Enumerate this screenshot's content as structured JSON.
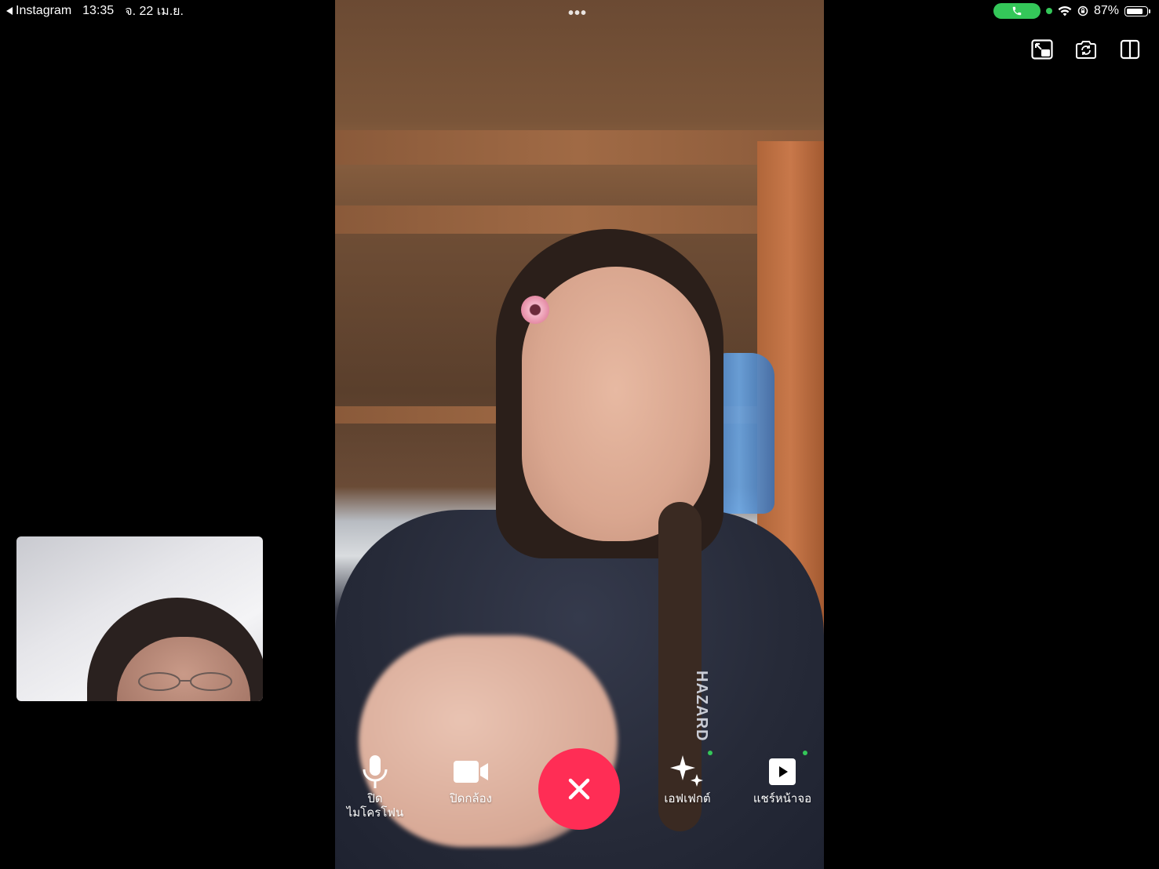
{
  "status_bar": {
    "back_app": "Instagram",
    "time": "13:35",
    "date": "จ. 22 เม.ย.",
    "battery": "87%",
    "battery_level": 0.87
  },
  "remote_video": {
    "shirt_text": "HAZARD"
  },
  "top_toolbar": {
    "icons": [
      "picture-in-picture-icon",
      "flip-camera-icon",
      "split-view-icon"
    ]
  },
  "controls": {
    "mute_label": "ปิด\nไมโครโฟน",
    "camera_label": "ปิดกล้อง",
    "effects_label": "เอฟเฟกต์",
    "share_label": "แชร์หน้าจอ",
    "end_call_icon": "close-icon"
  },
  "colors": {
    "end_call": "#ff2d55",
    "active_green": "#34c759"
  }
}
